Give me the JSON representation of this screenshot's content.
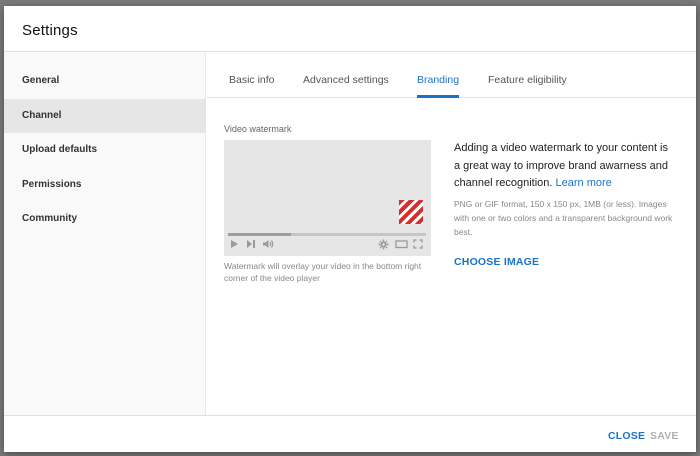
{
  "dialog": {
    "title": "Settings"
  },
  "sidebar": {
    "items": [
      {
        "label": "General",
        "active": false
      },
      {
        "label": "Channel",
        "active": true
      },
      {
        "label": "Upload defaults",
        "active": false
      },
      {
        "label": "Permissions",
        "active": false
      },
      {
        "label": "Community",
        "active": false
      }
    ]
  },
  "tabs": [
    {
      "label": "Basic info",
      "active": false
    },
    {
      "label": "Advanced settings",
      "active": false
    },
    {
      "label": "Branding",
      "active": true
    },
    {
      "label": "Feature eligibility",
      "active": false
    }
  ],
  "branding": {
    "section_label": "Video watermark",
    "preview_progress": 0.32,
    "caption": "Watermark will overlay your video in the bottom right corner of the video player",
    "description": "Adding a video watermark to your content is a great way to improve brand awarness and channel recognition.",
    "learn_more": "Learn more",
    "format_note": "PNG or GIF format, 150 x 150 px, 1MB (or less). Images with one or two colors and a transparent background work best.",
    "choose_image": "CHOOSE IMAGE"
  },
  "footer": {
    "close_label": "CLOSE",
    "save_label": "SAVE"
  },
  "colors": {
    "accent": "#1a73c8",
    "watermark": "#d32f2f"
  },
  "icons": [
    "play-icon",
    "next-icon",
    "volume-icon",
    "settings-gear-icon",
    "theater-mode-icon",
    "fullscreen-icon"
  ]
}
